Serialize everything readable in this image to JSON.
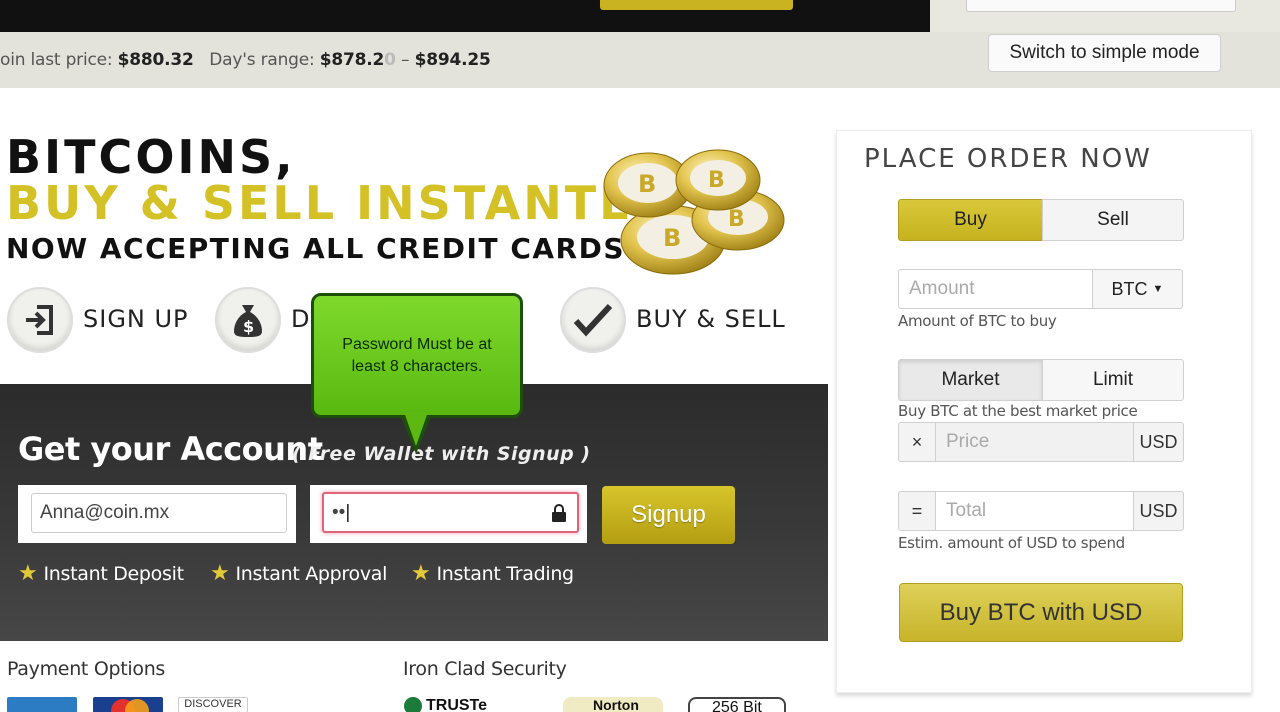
{
  "header": {
    "switch_mode_label": "Switch to simple mode"
  },
  "ticker": {
    "last_price_label": "oin last price:",
    "last_price": "$880.32",
    "range_label": "Day's range:",
    "range_low": "$878.2",
    "range_low_faded": "0",
    "range_sep": "–",
    "range_high": "$894.25"
  },
  "hero": {
    "line1": "BITCOINS,",
    "line2": "BUY & SELL INSTANTLY",
    "line3": "NOW ACCEPTING ALL CREDIT CARDS"
  },
  "steps": [
    {
      "label": "SIGN UP",
      "icon": "sign-in-icon"
    },
    {
      "label": "D",
      "icon": "money-bag-icon"
    },
    {
      "label": "BUY & SELL",
      "icon": "checkmark-icon"
    }
  ],
  "signup": {
    "title": "Get your Account",
    "subtitle": "( Free Wallet with Signup )",
    "email_value": "Anna@coin.mx",
    "password_value": "••",
    "button": "Signup",
    "features": [
      "Instant Deposit",
      "Instant Approval",
      "Instant Trading"
    ]
  },
  "tooltip": {
    "text": "Password Must be at least 8 characters."
  },
  "bottom": {
    "payment_title": "Payment Options",
    "security_title": "Iron Clad Security",
    "badges": [
      "TRUSTe",
      "Norton",
      "256 Bit"
    ]
  },
  "order": {
    "title": "PLACE ORDER NOW",
    "buy_tab": "Buy",
    "sell_tab": "Sell",
    "amount_placeholder": "Amount",
    "currency": "BTC",
    "amount_help": "Amount of BTC to buy",
    "market_tab": "Market",
    "limit_tab": "Limit",
    "market_help": "Buy BTC at the best market price",
    "times_symbol": "×",
    "price_placeholder": "Price",
    "price_unit": "USD",
    "equals_symbol": "=",
    "total_placeholder": "Total",
    "total_unit": "USD",
    "total_help": "Estim. amount of USD to spend",
    "submit": "Buy BTC with USD"
  },
  "colors": {
    "accent": "#d4c126",
    "tooltip": "#6cc81f",
    "dark_section": "#333333"
  }
}
